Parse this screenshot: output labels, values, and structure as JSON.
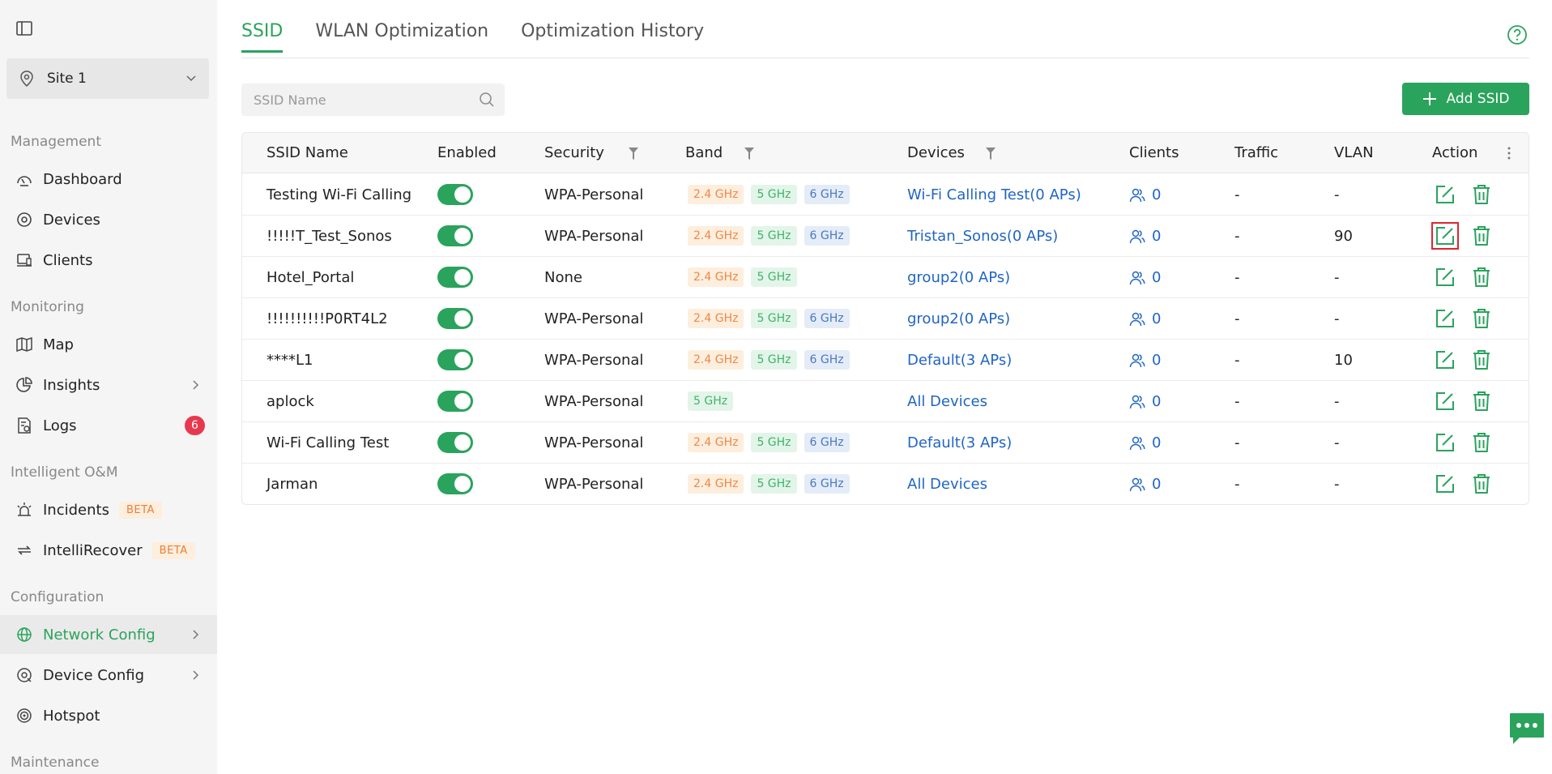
{
  "sidebar": {
    "site": "Site 1",
    "sections": {
      "management": "Management",
      "monitoring": "Monitoring",
      "intelligent": "Intelligent O&M",
      "configuration": "Configuration",
      "maintenance": "Maintenance"
    },
    "items": {
      "dashboard": "Dashboard",
      "devices": "Devices",
      "clients": "Clients",
      "map": "Map",
      "insights": "Insights",
      "logs": "Logs",
      "logs_badge": "6",
      "incidents": "Incidents",
      "incidents_badge": "BETA",
      "intellirecover": "IntelliRecover",
      "intellirecover_badge": "BETA",
      "network_config": "Network Config",
      "device_config": "Device Config",
      "hotspot": "Hotspot"
    }
  },
  "tabs": [
    "SSID",
    "WLAN Optimization",
    "Optimization History"
  ],
  "search": {
    "placeholder": "SSID Name"
  },
  "add_button": "Add SSID",
  "table": {
    "headers": {
      "ssid": "SSID Name",
      "enabled": "Enabled",
      "security": "Security",
      "band": "Band",
      "devices": "Devices",
      "clients": "Clients",
      "traffic": "Traffic",
      "vlan": "VLAN",
      "action": "Action"
    },
    "rows": [
      {
        "name": "Testing Wi-Fi Calling",
        "enabled": true,
        "security": "WPA-Personal",
        "bands": [
          "2.4 GHz",
          "5 GHz",
          "6 GHz"
        ],
        "devices": "Wi-Fi Calling Test(0 APs)",
        "clients": "0",
        "traffic": "-",
        "vlan": "-"
      },
      {
        "name": "!!!!!T_Test_Sonos",
        "enabled": true,
        "security": "WPA-Personal",
        "bands": [
          "2.4 GHz",
          "5 GHz",
          "6 GHz"
        ],
        "devices": "Tristan_Sonos(0 APs)",
        "clients": "0",
        "traffic": "-",
        "vlan": "90"
      },
      {
        "name": "Hotel_Portal",
        "enabled": true,
        "security": "None",
        "bands": [
          "2.4 GHz",
          "5 GHz"
        ],
        "devices": "group2(0 APs)",
        "clients": "0",
        "traffic": "-",
        "vlan": "-"
      },
      {
        "name": "!!!!!!!!!!P0RT4L2",
        "enabled": true,
        "security": "WPA-Personal",
        "bands": [
          "2.4 GHz",
          "5 GHz",
          "6 GHz"
        ],
        "devices": "group2(0 APs)",
        "clients": "0",
        "traffic": "-",
        "vlan": "-"
      },
      {
        "name": "****L1",
        "enabled": true,
        "security": "WPA-Personal",
        "bands": [
          "2.4 GHz",
          "5 GHz",
          "6 GHz"
        ],
        "devices": "Default(3 APs)",
        "clients": "0",
        "traffic": "-",
        "vlan": "10"
      },
      {
        "name": "aplock",
        "enabled": true,
        "security": "WPA-Personal",
        "bands": [
          "5 GHz"
        ],
        "devices": "All Devices",
        "clients": "0",
        "traffic": "-",
        "vlan": "-"
      },
      {
        "name": "Wi-Fi Calling Test",
        "enabled": true,
        "security": "WPA-Personal",
        "bands": [
          "2.4 GHz",
          "5 GHz",
          "6 GHz"
        ],
        "devices": "Default(3 APs)",
        "clients": "0",
        "traffic": "-",
        "vlan": "-"
      },
      {
        "name": "Jarman",
        "enabled": true,
        "security": "WPA-Personal",
        "bands": [
          "2.4 GHz",
          "5 GHz",
          "6 GHz"
        ],
        "devices": "All Devices",
        "clients": "0",
        "traffic": "-",
        "vlan": "-"
      }
    ]
  },
  "colors": {
    "accent": "#2aa35c",
    "link": "#2065c4",
    "badge": "#e8384f",
    "highlight": "#e0242f"
  }
}
